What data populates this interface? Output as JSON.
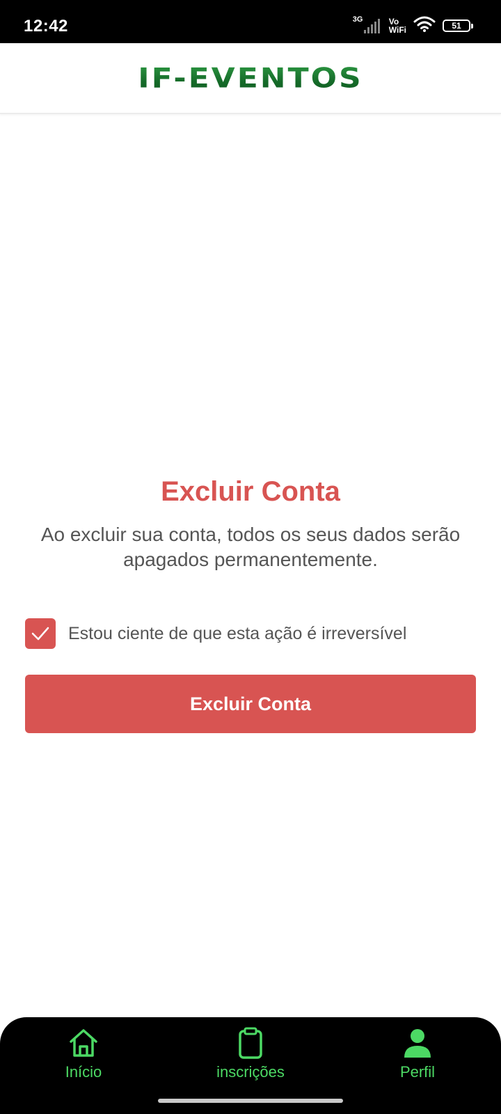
{
  "status_bar": {
    "time": "12:42",
    "network": "3G",
    "vowifi_top": "Vo",
    "vowifi_bottom": "WiFi",
    "battery": "51"
  },
  "header": {
    "logo_text": "IF-EVENTOS"
  },
  "main": {
    "title": "Excluir Conta",
    "description": "Ao excluir sua conta, todos os seus dados serão apagados permanentemente.",
    "checkbox_label": "Estou ciente de que esta ação é irreversível",
    "checkbox_checked": true,
    "delete_button_label": "Excluir Conta"
  },
  "bottom_nav": {
    "items": [
      {
        "label": "Início",
        "icon": "home-icon"
      },
      {
        "label": "inscrições",
        "icon": "clipboard-icon"
      },
      {
        "label": "Perfil",
        "icon": "person-icon"
      }
    ]
  },
  "colors": {
    "accent_red": "#d85452",
    "nav_green": "#4cd964",
    "logo_green": "#1f7a33"
  }
}
